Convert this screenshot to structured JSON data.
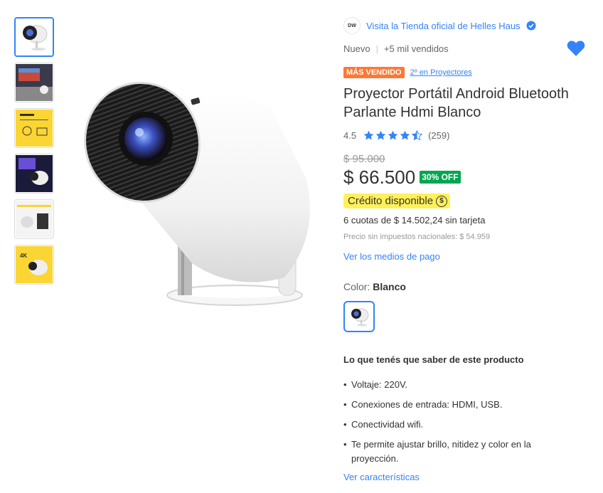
{
  "store": {
    "logo_text": "DW",
    "link_text": "Visita la Tienda oficial de Helles Haus"
  },
  "condition": {
    "state": "Nuevo",
    "separator": "|",
    "sold": "+5 mil vendidos"
  },
  "badges": {
    "best_seller": "MÁS VENDIDO",
    "category_rank": "2º en Proyectores"
  },
  "product": {
    "title": "Proyector Portátil Android Bluetooth Parlante Hdmi Blanco",
    "rating_value": "4.5",
    "rating_stars": 4.5,
    "review_count": "(259)",
    "old_price": "$ 95.000",
    "price": "$ 66.500",
    "discount": "30% OFF",
    "credit_label": "Crédito disponible",
    "installments": "6 cuotas de $ 14.502,24 sin tarjeta",
    "price_no_tax": "Precio sin impuestos nacionales: $ 54.959",
    "payment_link": "Ver los medios de pago"
  },
  "color": {
    "label": "Color: ",
    "value": "Blanco"
  },
  "features": {
    "title": "Lo que tenés que saber de este producto",
    "items": [
      "Voltaje: 220V.",
      "Conexiones de entrada: HDMI, USB.",
      "Conectividad wifi.",
      "Te permite ajustar brillo, nitidez y color en la proyección."
    ],
    "more_link": "Ver características"
  },
  "colors": {
    "link": "#3483fa",
    "best_seller": "#ff7733",
    "discount": "#00a650",
    "credit": "#fff159"
  },
  "icons": {
    "heart": "heart-icon",
    "verified": "verified-icon",
    "star": "star-icon",
    "coin": "coin-icon"
  }
}
